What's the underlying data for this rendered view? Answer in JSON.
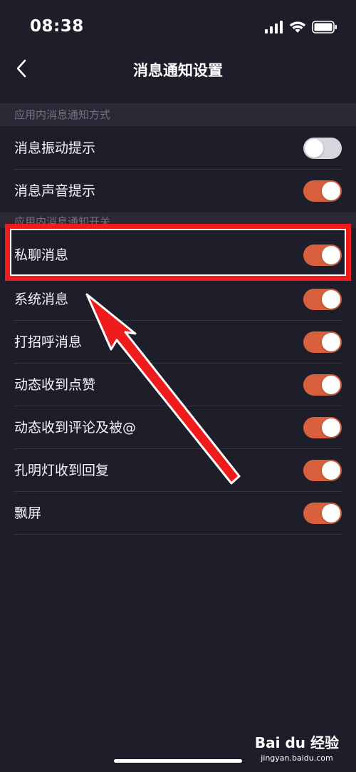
{
  "status_bar": {
    "time": "08:38"
  },
  "header": {
    "title": "消息通知设置"
  },
  "sections": [
    {
      "title": "应用内消息通知方式",
      "items": [
        {
          "label": "消息振动提示",
          "enabled": false
        },
        {
          "label": "消息声音提示",
          "enabled": true
        }
      ]
    },
    {
      "title": "应用内消息通知开关",
      "items": [
        {
          "label": "私聊消息",
          "enabled": true
        },
        {
          "label": "系统消息",
          "enabled": true
        },
        {
          "label": "打招呼消息",
          "enabled": true
        },
        {
          "label": "动态收到点赞",
          "enabled": true
        },
        {
          "label": "动态收到评论及被@",
          "enabled": true
        },
        {
          "label": "孔明灯收到回复",
          "enabled": true
        },
        {
          "label": "飘屏",
          "enabled": true
        }
      ]
    }
  ],
  "colors": {
    "background": "#1e1e2a",
    "section_header_bg": "#2a2a36",
    "toggle_on": "#d9603c",
    "toggle_off": "#d6d7dc",
    "annotation": "#ee1c1c"
  },
  "watermark": {
    "logo": "Bai du 经验",
    "url": "jingyan.baidu.com"
  }
}
